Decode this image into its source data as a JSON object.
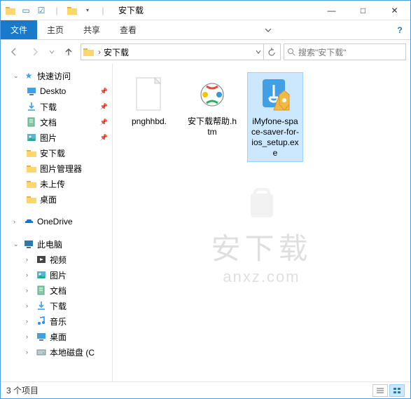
{
  "titlebar": {
    "title": "安下载"
  },
  "win_controls": {
    "min": "—",
    "max": "□",
    "close": "✕"
  },
  "ribbon": {
    "file": "文件",
    "tabs": [
      "主页",
      "共享",
      "查看"
    ]
  },
  "address": {
    "path": "安下载",
    "search_placeholder": "搜索\"安下载\""
  },
  "sidebar": {
    "quick_access": "快速访问",
    "quick_items": [
      {
        "label": "Deskto",
        "icon": "desktop",
        "pinned": true
      },
      {
        "label": "下载",
        "icon": "downloads",
        "pinned": true
      },
      {
        "label": "文档",
        "icon": "documents",
        "pinned": true
      },
      {
        "label": "图片",
        "icon": "pictures",
        "pinned": true
      },
      {
        "label": "安下载",
        "icon": "folder",
        "pinned": false
      },
      {
        "label": "图片管理器",
        "icon": "folder",
        "pinned": false
      },
      {
        "label": "未上传",
        "icon": "folder",
        "pinned": false
      },
      {
        "label": "桌面",
        "icon": "folder",
        "pinned": false
      }
    ],
    "onedrive": "OneDrive",
    "this_pc": "此电脑",
    "pc_items": [
      {
        "label": "视频",
        "icon": "videos"
      },
      {
        "label": "图片",
        "icon": "pictures"
      },
      {
        "label": "文档",
        "icon": "documents"
      },
      {
        "label": "下载",
        "icon": "downloads"
      },
      {
        "label": "音乐",
        "icon": "music"
      },
      {
        "label": "桌面",
        "icon": "desktop"
      },
      {
        "label": "本地磁盘 (C",
        "icon": "disk"
      }
    ]
  },
  "files": [
    {
      "name": "pnghhbd.",
      "type": "blank"
    },
    {
      "name": "安下载帮助.htm",
      "type": "htm"
    },
    {
      "name": "iMyfone-space-saver-for-ios_setup.exe",
      "type": "exe",
      "selected": true
    }
  ],
  "status": {
    "count_text": "3 个项目"
  },
  "watermark": {
    "cn": "安下载",
    "en": "anxz.com"
  }
}
